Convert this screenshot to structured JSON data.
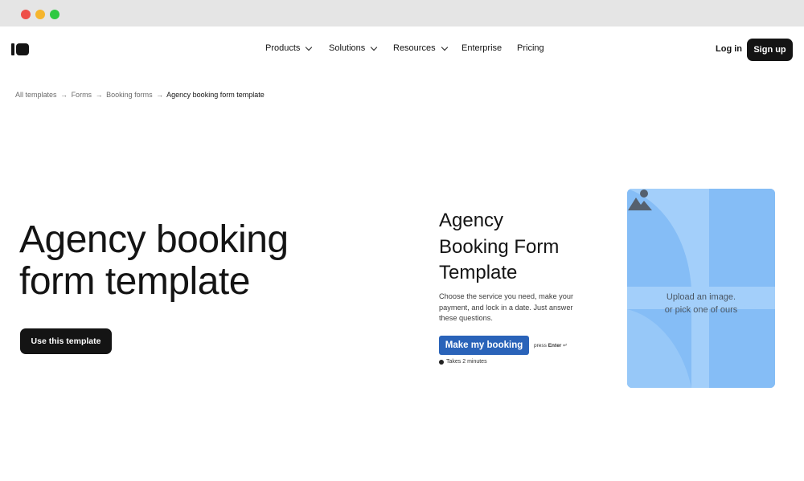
{
  "nav": {
    "items": [
      {
        "label": "Products",
        "has_dropdown": true
      },
      {
        "label": "Solutions",
        "has_dropdown": true
      },
      {
        "label": "Resources",
        "has_dropdown": true
      },
      {
        "label": "Enterprise",
        "has_dropdown": false
      },
      {
        "label": "Pricing",
        "has_dropdown": false
      }
    ],
    "login_label": "Log in",
    "signup_label": "Sign up"
  },
  "breadcrumb": {
    "items": [
      "All templates",
      "Forms",
      "Booking forms"
    ],
    "separator": "→",
    "current": "Agency booking form template"
  },
  "hero": {
    "title_line1": "Agency booking",
    "title_line2": "form template",
    "cta_label": "Use this template"
  },
  "preview": {
    "title_line1": "Agency",
    "title_line2": "Booking Form",
    "title_line3": "Template",
    "description": "Choose the service you need, make your payment, and lock in a date. Just answer these questions.",
    "button_label": "Make my booking",
    "press_text": "press",
    "press_key": "Enter",
    "enter_glyph": "↵",
    "duration": "Takes 2 minutes",
    "image_placeholder_line1": "Upload an image.",
    "image_placeholder_line2": "or pick one of ours",
    "image_icon": "mountain-image-icon"
  },
  "colors": {
    "dark": "#141414",
    "booking_button": "#2a63b9",
    "image_card": "#85bdf6",
    "traffic_red": "#ee4f48",
    "traffic_yellow": "#f5b52e",
    "traffic_green": "#2ec941"
  }
}
